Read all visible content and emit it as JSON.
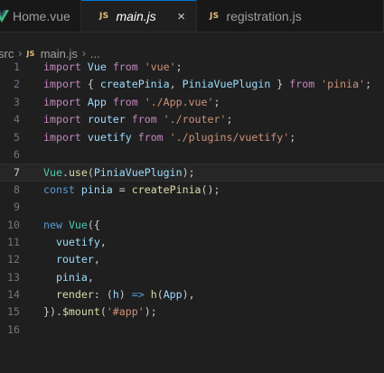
{
  "tabs": [
    {
      "label": "Home.vue",
      "icon": "vue-icon",
      "active": false
    },
    {
      "label": "main.js",
      "icon": "js-icon",
      "active": true
    },
    {
      "label": "registration.js",
      "icon": "js-icon",
      "active": false
    }
  ],
  "js_badge": "JS",
  "close_glyph": "×",
  "breadcrumb": {
    "folder": "src",
    "file": "main.js",
    "more": "..."
  },
  "current_line": 7,
  "lines": [
    {
      "n": "1",
      "tokens": [
        [
          "kw",
          "import"
        ],
        [
          "pl",
          " "
        ],
        [
          "id",
          "Vue"
        ],
        [
          "pl",
          " "
        ],
        [
          "kw",
          "from"
        ],
        [
          "pl",
          " "
        ],
        [
          "str",
          "'vue'"
        ],
        [
          "pl",
          ";"
        ]
      ]
    },
    {
      "n": "2",
      "tokens": [
        [
          "kw",
          "import"
        ],
        [
          "pl",
          " { "
        ],
        [
          "id",
          "createPinia"
        ],
        [
          "pl",
          ", "
        ],
        [
          "id",
          "PiniaVuePlugin"
        ],
        [
          "pl",
          " } "
        ],
        [
          "kw",
          "from"
        ],
        [
          "pl",
          " "
        ],
        [
          "str",
          "'pinia'"
        ],
        [
          "pl",
          ";"
        ]
      ]
    },
    {
      "n": "3",
      "tokens": [
        [
          "kw",
          "import"
        ],
        [
          "pl",
          " "
        ],
        [
          "id",
          "App"
        ],
        [
          "pl",
          " "
        ],
        [
          "kw",
          "from"
        ],
        [
          "pl",
          " "
        ],
        [
          "str",
          "'./App.vue'"
        ],
        [
          "pl",
          ";"
        ]
      ]
    },
    {
      "n": "4",
      "tokens": [
        [
          "kw",
          "import"
        ],
        [
          "pl",
          " "
        ],
        [
          "id",
          "router"
        ],
        [
          "pl",
          " "
        ],
        [
          "kw",
          "from"
        ],
        [
          "pl",
          " "
        ],
        [
          "str",
          "'./router'"
        ],
        [
          "pl",
          ";"
        ]
      ]
    },
    {
      "n": "5",
      "tokens": [
        [
          "kw",
          "import"
        ],
        [
          "pl",
          " "
        ],
        [
          "id",
          "vuetify"
        ],
        [
          "pl",
          " "
        ],
        [
          "kw",
          "from"
        ],
        [
          "pl",
          " "
        ],
        [
          "str",
          "'./plugins/vuetify'"
        ],
        [
          "pl",
          ";"
        ]
      ]
    },
    {
      "n": "6",
      "tokens": []
    },
    {
      "n": "7",
      "tokens": [
        [
          "cls",
          "Vue"
        ],
        [
          "pl",
          "."
        ],
        [
          "fn",
          "use"
        ],
        [
          "pl",
          "("
        ],
        [
          "id",
          "PiniaVuePlugin"
        ],
        [
          "pl",
          ");"
        ]
      ]
    },
    {
      "n": "8",
      "tokens": [
        [
          "kb",
          "const"
        ],
        [
          "pl",
          " "
        ],
        [
          "id",
          "pinia"
        ],
        [
          "pl",
          " = "
        ],
        [
          "fn",
          "createPinia"
        ],
        [
          "pl",
          "();"
        ]
      ]
    },
    {
      "n": "9",
      "tokens": []
    },
    {
      "n": "10",
      "tokens": [
        [
          "kb",
          "new"
        ],
        [
          "pl",
          " "
        ],
        [
          "cls",
          "Vue"
        ],
        [
          "pl",
          "({"
        ]
      ]
    },
    {
      "n": "11",
      "tokens": [
        [
          "pl",
          "  "
        ],
        [
          "id",
          "vuetify"
        ],
        [
          "pl",
          ","
        ]
      ]
    },
    {
      "n": "12",
      "tokens": [
        [
          "pl",
          "  "
        ],
        [
          "id",
          "router"
        ],
        [
          "pl",
          ","
        ]
      ]
    },
    {
      "n": "13",
      "tokens": [
        [
          "pl",
          "  "
        ],
        [
          "id",
          "pinia"
        ],
        [
          "pl",
          ","
        ]
      ]
    },
    {
      "n": "14",
      "tokens": [
        [
          "pl",
          "  "
        ],
        [
          "fn",
          "render"
        ],
        [
          "pl",
          ": ("
        ],
        [
          "id",
          "h"
        ],
        [
          "pl",
          ") "
        ],
        [
          "kb",
          "=>"
        ],
        [
          "pl",
          " "
        ],
        [
          "fn",
          "h"
        ],
        [
          "pl",
          "("
        ],
        [
          "id",
          "App"
        ],
        [
          "pl",
          "),"
        ]
      ]
    },
    {
      "n": "15",
      "tokens": [
        [
          "pl",
          "})."
        ],
        [
          "fn",
          "$mount"
        ],
        [
          "pl",
          "("
        ],
        [
          "str",
          "'#app'"
        ],
        [
          "pl",
          ");"
        ]
      ]
    },
    {
      "n": "16",
      "tokens": []
    }
  ],
  "colors": {
    "background": "#1f1f1f",
    "keyword_import": "#c586c0",
    "keyword_decl": "#569cd6",
    "identifier": "#9cdcfe",
    "function": "#dcdcaa",
    "string": "#ce9178",
    "class": "#4ec9b0",
    "active_tab_border": "#0078d4"
  }
}
